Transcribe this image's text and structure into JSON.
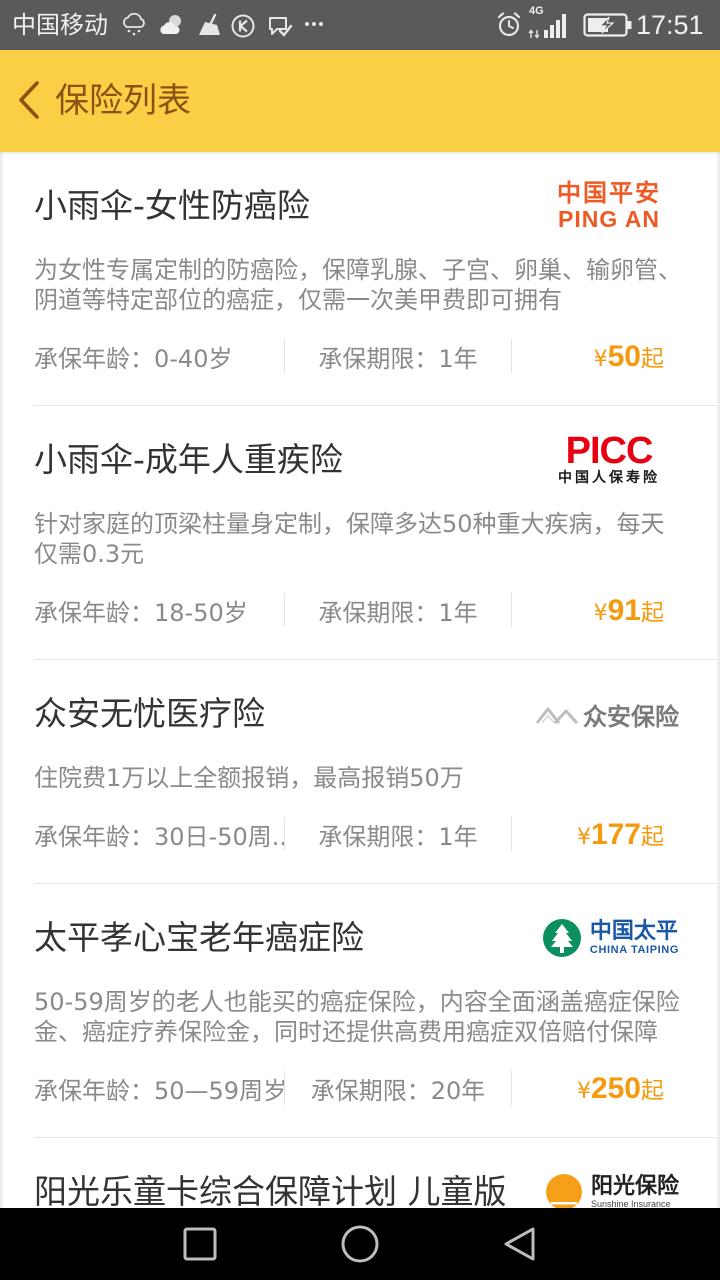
{
  "theme": {
    "status_bar_bg": "#5a5a5a",
    "header_bg": "#f9cf45",
    "header_text": "#8a5212",
    "price_color": "#f59a0e",
    "nav_bar_bg": "#000000"
  },
  "status_bar": {
    "carrier": "中国移动",
    "notification_icons": [
      "rain-cloud-icon",
      "partly-cloudy-icon",
      "broom-icon",
      "k-circle-icon",
      "message-check-icon",
      "more-dots-icon"
    ],
    "alarm_icon": "alarm-clock-icon",
    "network_type": "4G",
    "signal_icon": "signal-strength-icon",
    "battery_icon": "battery-charging-icon",
    "time": "17:51"
  },
  "header": {
    "back_icon": "chevron-left-icon",
    "title": "保险列表"
  },
  "items": [
    {
      "title": "小雨伞-女性防癌险",
      "description": "为女性专属定制的防癌险，保障乳腺、子宫、卵巢、输卵管、阴道等特定部位的癌症，仅需一次美甲费即可拥有",
      "age": "承保年龄：0-40岁",
      "term": "承保期限：1年",
      "price": {
        "currency": "¥",
        "amount": "50",
        "suffix": "起"
      },
      "insurer": {
        "logo_icon": "ping-an-logo",
        "name": "中国平安",
        "subname": "PING AN",
        "brand_color": "#ef5a24"
      }
    },
    {
      "title": "小雨伞-成年人重疾险",
      "description": "针对家庭的顶梁柱量身定制，保障多达50种重大疾病，每天仅需0.3元",
      "age": "承保年龄：18-50岁",
      "term": "承保期限：1年",
      "price": {
        "currency": "¥",
        "amount": "91",
        "suffix": "起"
      },
      "insurer": {
        "logo_icon": "picc-logo",
        "name": "PICC",
        "subname": "中国人保寿险",
        "brand_color": "#e60012"
      }
    },
    {
      "title": "众安无忧医疗险",
      "description": "住院费1万以上全额报销，最高报销50万",
      "age": "承保年龄：30日-50周...",
      "term": "承保期限：1年",
      "price": {
        "currency": "¥",
        "amount": "177",
        "suffix": "起"
      },
      "insurer": {
        "logo_icon": "zhongan-logo",
        "name": "众安保险",
        "brand_color": "#7a7a7a"
      }
    },
    {
      "title": "太平孝心宝老年癌症险",
      "description": "50-59周岁的老人也能买的癌症保险，内容全面涵盖癌症保险金、癌症疗养保险金，同时还提供高费用癌症双倍赔付保障",
      "age": "承保年龄：50—59周岁",
      "term": "承保期限：20年",
      "price": {
        "currency": "¥",
        "amount": "250",
        "suffix": "起"
      },
      "insurer": {
        "logo_icon": "china-taiping-logo",
        "name": "中国太平",
        "subname": "CHINA TAIPING",
        "brand_color": "#1a58a6",
        "emblem_color": "#0b8f5e"
      }
    },
    {
      "title": "阳光乐童卡综合保障计划 儿童版",
      "insurer": {
        "logo_icon": "sunshine-insurance-logo",
        "name": "阳光保险",
        "subname": "Sunshine Insurance",
        "brand_color": "#f6a01a"
      }
    }
  ],
  "nav_bar": {
    "icons": [
      "recent-apps-icon",
      "home-icon",
      "back-icon"
    ]
  }
}
